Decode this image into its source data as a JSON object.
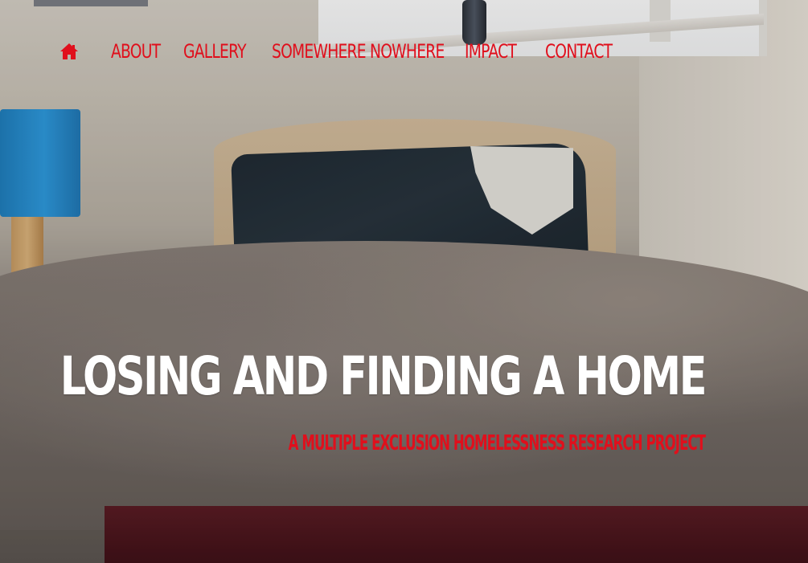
{
  "nav": {
    "home_icon": "home-icon",
    "items": [
      {
        "label": "ABOUT"
      },
      {
        "label": "GALLERY"
      },
      {
        "label": "SOMEWHERE NOWHERE"
      },
      {
        "label": "IMPACT"
      },
      {
        "label": "CONTACT"
      }
    ]
  },
  "hero": {
    "title": "LOSING AND FINDING A HOME",
    "subtitle": "A MULTIPLE EXCLUSION HOMELESSNESS RESEARCH PROJECT"
  },
  "colors": {
    "accent": "#e00f1c",
    "title": "#ffffff"
  }
}
